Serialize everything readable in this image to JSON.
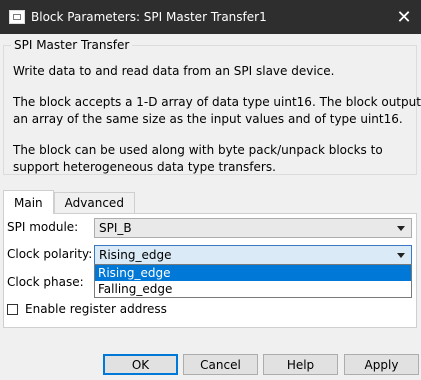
{
  "window": {
    "title": "Block Parameters: SPI Master Transfer1",
    "close_glyph": "✕"
  },
  "block": {
    "name": "SPI Master Transfer",
    "description": [
      "Write data to and read data from an SPI slave device.",
      "The block accepts a 1-D array of data type uint16. The block outputs",
      "an array of the same size as the input values and of type uint16.",
      "The block can be used along with byte pack/unpack blocks to",
      "support heterogeneous data type transfers."
    ]
  },
  "tabs": [
    {
      "label": "Main",
      "active": true
    },
    {
      "label": "Advanced",
      "active": false
    }
  ],
  "params": {
    "spi_module": {
      "label": "SPI module:",
      "value": "SPI_B"
    },
    "clock_polarity": {
      "label": "Clock polarity:",
      "value": "Rising_edge",
      "options": [
        "Rising_edge",
        "Falling_edge"
      ],
      "highlighted": "Rising_edge"
    },
    "clock_phase": {
      "label": "Clock phase:"
    },
    "enable_register_address": {
      "label": "Enable register address",
      "checked": false
    }
  },
  "buttons": {
    "ok": "OK",
    "cancel": "Cancel",
    "help": "Help",
    "apply": "Apply"
  },
  "colors": {
    "titlebar": "#2e2e2e",
    "selection": "#0078d7",
    "focus": "#3a78c2"
  }
}
